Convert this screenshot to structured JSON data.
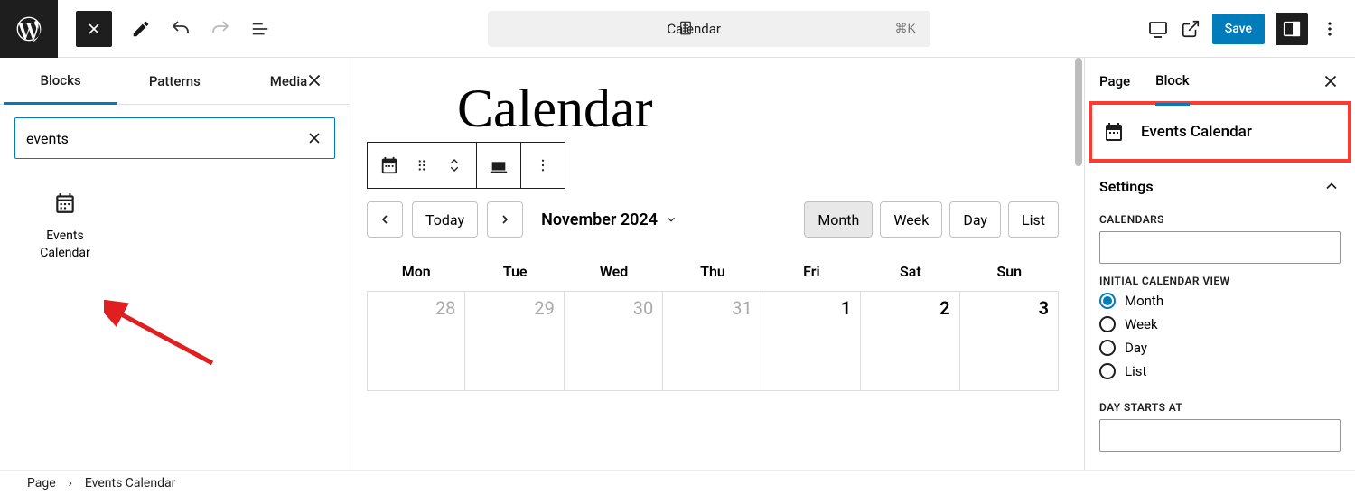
{
  "topbar": {
    "doc_title": "Calendar",
    "shortcut": "⌘K",
    "save_label": "Save"
  },
  "inserter": {
    "tabs": {
      "blocks": "Blocks",
      "patterns": "Patterns",
      "media": "Media"
    },
    "search_value": "events",
    "result_label": "Events\nCalendar"
  },
  "canvas": {
    "title": "Calendar",
    "today": "Today",
    "month_label": "November 2024",
    "views": {
      "month": "Month",
      "week": "Week",
      "day": "Day",
      "list": "List"
    },
    "days": [
      "Mon",
      "Tue",
      "Wed",
      "Thu",
      "Fri",
      "Sat",
      "Sun"
    ],
    "row1": [
      "28",
      "29",
      "30",
      "31",
      "1",
      "2",
      "3"
    ]
  },
  "sidebar": {
    "tabs": {
      "page": "Page",
      "block": "Block"
    },
    "block_name": "Events Calendar",
    "settings_label": "Settings",
    "calendars_label": "CALENDARS",
    "initial_view_label": "INITIAL CALENDAR VIEW",
    "view_options": {
      "month": "Month",
      "week": "Week",
      "day": "Day",
      "list": "List"
    },
    "day_starts_label": "DAY STARTS AT"
  },
  "breadcrumb": {
    "root": "Page",
    "current": "Events Calendar"
  }
}
